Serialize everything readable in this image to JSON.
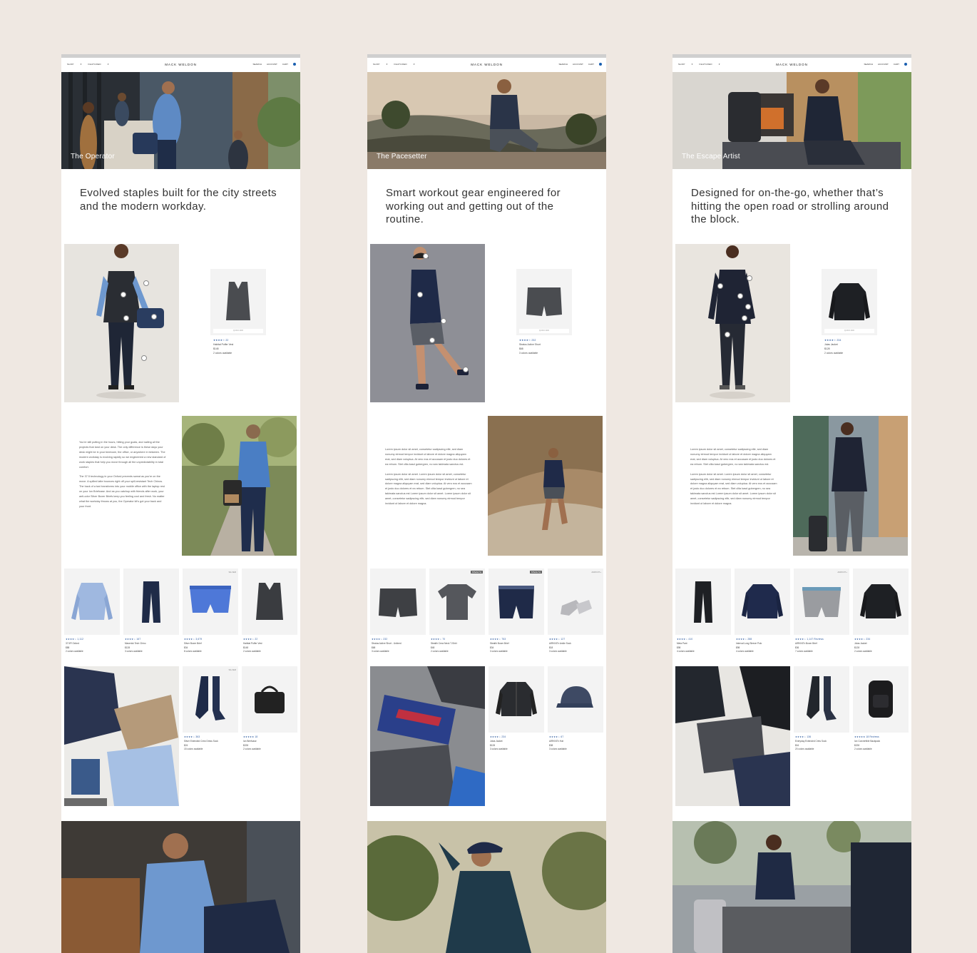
{
  "nav": {
    "shop": "SHOP",
    "featured": "FEATURED",
    "logo": "MACK WELDON",
    "search": "SEARCH",
    "account": "ACCOUNT",
    "cart": "CART"
  },
  "quick_add": "QUICK ADD",
  "pages": [
    {
      "hero_caption": "The Operator",
      "headline": "Evolved staples built for the city streets and the modern workday.",
      "feature": {
        "rating": "★★★★☆ 22",
        "name": "Habitat Puffer Vest",
        "price": "$148",
        "colors": "2 colors available"
      },
      "body": [
        "You're still putting in the hours, hitting your goals, and nailing all the projects that land on your desk. The only difference is these days your desk might be in your bedroom, the office, or anywhere in between. The modern workday is evolving rapidly so we engineered a new standard of work staples that help you move through all the unpredictability in total comfort.",
        "The 37.5 technology in your Oxford prevents sweat as you're on the move. A spilled latte bounces right off your spill-resistant Tech Chinos. The back of a taxi transforms into your mobile office with the laptop rest on your Ion Briefcase. And as you catchup with friends after work, your anti-odor Silver Boxer Briefs keep you feeling cool and fresh. No matter what the workday throws at you, the Operator kit's got your back and your front."
      ],
      "row1": [
        {
          "tag": "",
          "rating": "★★★★☆ 1,112",
          "name": "37.5® Oxford",
          "price": "$88",
          "colors": "2 colors available"
        },
        {
          "tag": "",
          "rating": "★★★★☆ 167",
          "name": "Maverick Tech Chino",
          "price": "$128",
          "colors": "3 colors available"
        },
        {
          "tag": "SILVER",
          "rating": "★★★★☆ 3,679",
          "name": "Silver Boxer Brief",
          "price": "$34",
          "colors": "8 colors available"
        },
        {
          "tag": "",
          "rating": "★★★★☆ 22",
          "name": "Habitat Puffer Vest",
          "price": "$148",
          "colors": "2 colors available"
        }
      ],
      "row2": [
        {
          "tag": "SILVER",
          "rating": "★★★★☆ 363",
          "name": "Silver Extended Crew Dress Sock",
          "price": "$24",
          "colors": "15 colors available"
        },
        {
          "tag": "",
          "rating": "★★★★★ 18",
          "name": "Ion Briefcase",
          "price": "$228",
          "colors": "2 colors available"
        }
      ]
    },
    {
      "hero_caption": "The Pacesetter",
      "headline": "Smart workout gear engineered for working out and getting out of the routine.",
      "feature": {
        "rating": "★★★★☆ 232",
        "name": "Stratus Active Short",
        "price": "$68",
        "colors": "3 colors available"
      },
      "body": [
        "Lorem ipsum dolor sit amet, consetetur sadipscing elitr, sed diam nonumy eirmod tempor invidunt ut labore et dolore magna aliquyam erat, sed diam voluptua. At vero eos et accusam et justo duo dolores et ea rebum. Stet clita kasd gubergren, no sea takimata sanctus est.",
        "Lorem ipsum dolor sit amet. Lorem ipsum dolor sit amet, consetetur sadipscing elitr, sed diam nonumy eirmod tempor invidunt ut labore et dolore magna aliquyam erat, sed diam voluptua. At vero eos et accusam et justo duo dolores et ea rebum. Stet clita kasd gubergren, no sea takimata sanctus est Lorem ipsum dolor sit amet. Lorem ipsum dolor sit amet, consetetur sadipscing elitr, sed diam nonumy eirmod tempor invidunt ut labore et dolore magna."
      ],
      "row1": [
        {
          "tag": "",
          "rating": "★★★★☆ 232",
          "name": "Stratus Active Short - Unlined",
          "price": "$68",
          "colors": "3 colors available"
        },
        {
          "tag": "STEALTH",
          "rating": "★★★★☆ 70",
          "name": "Stealth Crew Neck T-Shirt",
          "price": "$48",
          "colors": "2 colors available"
        },
        {
          "tag": "STEALTH",
          "rating": "★★★★☆ 753",
          "name": "Stealth Boxer Brief",
          "price": "$34",
          "colors": "3 colors available"
        },
        {
          "tag": "AIRKNIT+",
          "rating": "★★★★☆ 127",
          "name": "AIRKNITx Ankle Sock",
          "price": "$18",
          "colors": "3 colors available"
        }
      ],
      "row2": [
        {
          "tag": "",
          "rating": "★★★★☆ 234",
          "name": "Jolas Jacket",
          "price": "$128",
          "colors": "3 colors available"
        },
        {
          "tag": "",
          "rating": "★★★★☆ 67",
          "name": "AIRKNITx Hat",
          "price": "$38",
          "colors": "3 colors available"
        }
      ]
    },
    {
      "hero_caption": "The Escape Artist",
      "headline": "Designed for on-the-go, whether that’s hitting the open road or strolling around the block.",
      "feature": {
        "rating": "★★★★☆ 234",
        "name": "Jolas Jacket",
        "price": "$128",
        "colors": "2 colors available"
      },
      "body": [
        "Lorem ipsum dolor sit amet, consetetur sadipscing elitr, sed diam nonumy eirmod tempor invidunt ut labore et dolore magna aliquyam erat, sed diam voluptua. At vero eos et accusam et justo duo dolores et ea rebum. Stet clita kasd gubergren, no sea takimata sanctus est.",
        "Lorem ipsum dolor sit amet. Lorem ipsum dolor sit amet, consetetur sadipscing elitr, sed diam nonumy eirmod tempor invidunt ut labore et dolore magna aliquyam erat, sed diam voluptua. At vero eos et accusam et justo duo dolores et ea rebum. Stet clita kasd gubergren, no sea takimata sanctus est Lorem ipsum dolor sit amet. Lorem ipsum dolor sit amet, consetetur sadipscing elitr, sed diam nonumy eirmod tempor invidunt ut labore et dolore magna."
      ],
      "row1": [
        {
          "tag": "",
          "rating": "★★★★☆ 410",
          "name": "Meta Pant",
          "price": "$98",
          "colors": "4 colors available"
        },
        {
          "tag": "",
          "rating": "★★★★☆ 288",
          "name": "Interval Long Sleeve Polo",
          "price": "$98",
          "colors": "4 colors available"
        },
        {
          "tag": "AIRKNIT+",
          "rating": "★★★★☆ 1,147 Reviews",
          "name": "AIRKNITx Boxer Brief",
          "price": "$36",
          "colors": "7 colors available"
        },
        {
          "tag": "",
          "rating": "★★★★☆ 234",
          "name": "Jolas Jacket",
          "price": "$128",
          "colors": "2 colors available"
        }
      ],
      "row2": [
        {
          "tag": "",
          "rating": "★★★★☆ 136",
          "name": "Everyday Extended Crew Sock",
          "price": "$16",
          "colors": "20 colors available"
        },
        {
          "tag": "",
          "rating": "★★★★★ 18 Reviews",
          "name": "Ion Convertible Backpack",
          "price": "$228",
          "colors": "2 colors available"
        }
      ]
    }
  ],
  "colors": {
    "background": "#efe8e2",
    "rating_blue": "#1f4f99",
    "cart_badge": "#1a5fb0"
  }
}
